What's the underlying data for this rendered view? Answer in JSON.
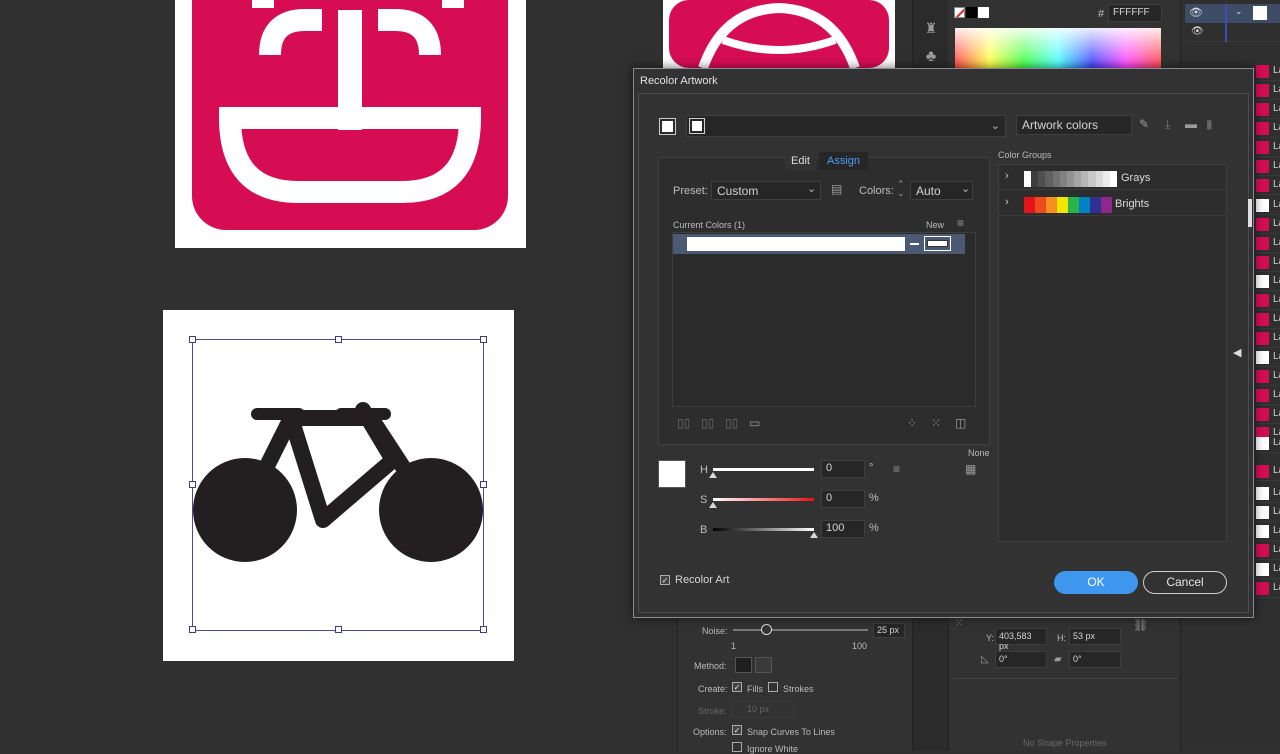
{
  "recolor": {
    "title": "Recolor Artwork",
    "artwork_colors": "Artwork colors",
    "tab_edit": "Edit",
    "tab_assign": "Assign",
    "preset_label": "Preset:",
    "preset_value": "Custom",
    "colors_label": "Colors:",
    "colors_value": "Auto",
    "current_colors": "Current Colors (1)",
    "new_label": "New",
    "color_groups_label": "Color Groups",
    "groups": [
      {
        "name": "Grays",
        "colors": [
          "#ffffff",
          "#3d3d3d",
          "#4f4f4f",
          "#606060",
          "#717171",
          "#828282",
          "#939393",
          "#a4a4a4",
          "#b6b6b6",
          "#c8c8c8",
          "#dadada",
          "#ececec",
          "#ffffff"
        ]
      },
      {
        "name": "Brights",
        "colors": [
          "#e3151a",
          "#ee4a1d",
          "#f7901e",
          "#f4e500",
          "#2ab34b",
          "#0083c4",
          "#2e3192",
          "#8f278f"
        ]
      }
    ],
    "h_label": "H",
    "h_value": "0",
    "h_unit": "°",
    "s_label": "S",
    "s_value": "0",
    "s_unit": "%",
    "b_label": "B",
    "b_value": "100",
    "b_unit": "%",
    "none_label": "None",
    "recolor_art": "Recolor Art",
    "ok": "OK",
    "cancel": "Cancel"
  },
  "color_panel": {
    "hex_symbol": "#",
    "hex_value": "FFFFFF"
  },
  "image_trace": {
    "noise_label": "Noise:",
    "noise_value": "25 px",
    "noise_min": "1",
    "noise_max": "100",
    "method_label": "Method:",
    "create_label": "Create:",
    "fills": "Fills",
    "strokes": "Strokes",
    "stroke_label": "Stroke:",
    "stroke_value": "10 px",
    "options_label": "Options:",
    "snap": "Snap Curves To Lines",
    "ignore_white": "Ignore White"
  },
  "transform": {
    "y_label": "Y:",
    "y_value": "403,583 px",
    "h_label": "H:",
    "h_value": "53 px",
    "angle_value": "0°",
    "shear_value": "0°",
    "no_shape": "No Shape Properties"
  },
  "layers": {
    "label_prefix": "La"
  }
}
